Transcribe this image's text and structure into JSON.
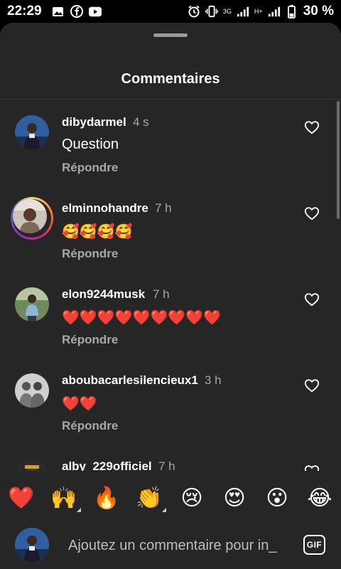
{
  "status_bar": {
    "time": "22:29",
    "network_label": "3G",
    "signal_label": "H+",
    "battery": "30 %",
    "icons": [
      "gallery-icon",
      "facebook-icon",
      "youtube-icon",
      "alarm-icon",
      "vibrate-icon",
      "signal-icon",
      "battery-icon"
    ]
  },
  "sheet": {
    "title": "Commentaires"
  },
  "comments": [
    {
      "username": "dibydarmel",
      "time": "4 s",
      "text": "Question",
      "reply": "Répondre"
    },
    {
      "username": "elminnohandre",
      "time": "7 h",
      "text": "🥰🥰🥰🥰",
      "reply": "Répondre"
    },
    {
      "username": "elon9244musk",
      "time": "7 h",
      "text": "❤️❤️❤️❤️❤️❤️❤️❤️❤️",
      "reply": "Répondre"
    },
    {
      "username": "aboubacarlesilencieux1",
      "time": "3 h",
      "text": "❤️❤️",
      "reply": "Répondre"
    },
    {
      "username": "alby_229officiel",
      "time": "7 h",
      "text": "",
      "reply": ""
    }
  ],
  "quick_emojis": [
    "❤️",
    "🙌",
    "🔥",
    "👏",
    "😢",
    "😍",
    "😮",
    "😂"
  ],
  "composer": {
    "placeholder": "Ajoutez un commentaire pour in_",
    "gif_label": "GIF"
  },
  "colors": {
    "sheet_background": "#262626",
    "secondary_text": "#a8a8a8",
    "heart_red": "#e3122f"
  }
}
